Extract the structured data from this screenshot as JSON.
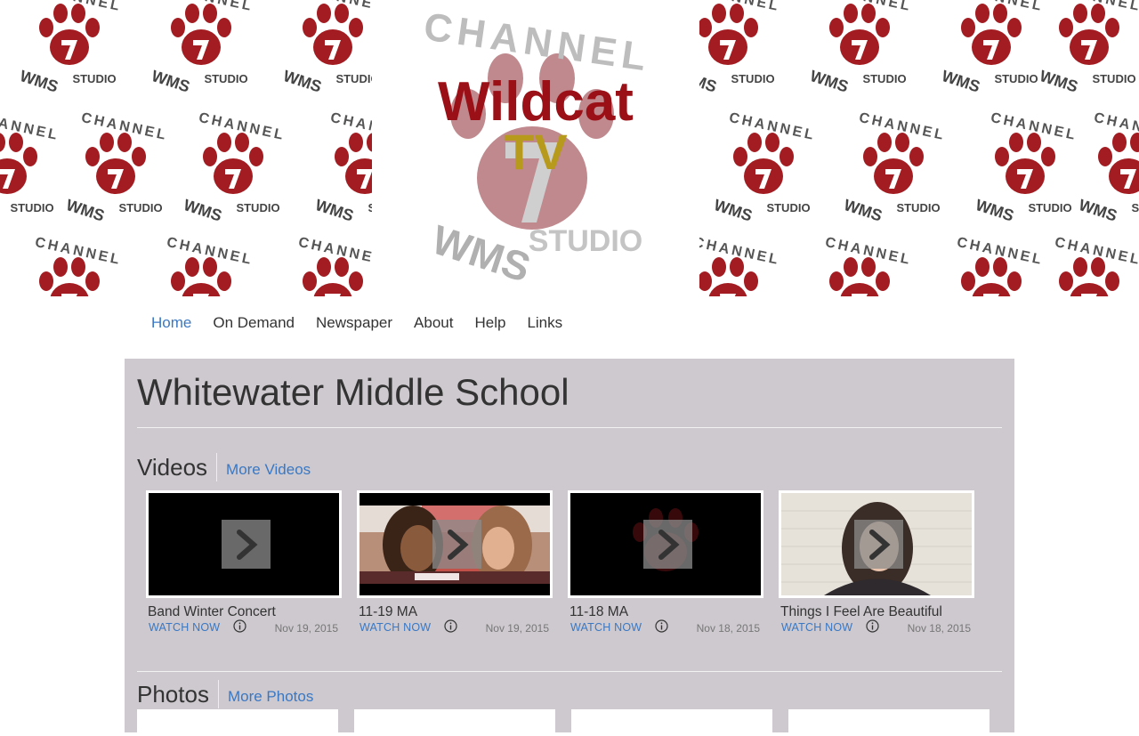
{
  "banner": {
    "tile_top_text": "CHANNEL",
    "tile_bottom_text": "WMS",
    "tile_side_text": "STUDIO",
    "tile_number": "7",
    "logo_title": "Wildcat",
    "logo_subtitle": "TV",
    "colors": {
      "paw": "#a21c21",
      "logo_red": "#9a1016",
      "logo_gold": "#b79a1c",
      "gray_text": "#8a8a8a"
    }
  },
  "nav": {
    "items": [
      {
        "label": "Home",
        "active": true
      },
      {
        "label": "On Demand",
        "active": false
      },
      {
        "label": "Newspaper",
        "active": false
      },
      {
        "label": "About",
        "active": false
      },
      {
        "label": "Help",
        "active": false
      },
      {
        "label": "Links",
        "active": false
      }
    ]
  },
  "page": {
    "title": "Whitewater Middle School"
  },
  "videos": {
    "title": "Videos",
    "more_link": "More Videos",
    "items": [
      {
        "title": "Band Winter Concert",
        "action": "WATCH NOW",
        "date": "Nov 19, 2015",
        "thumb_icon": "blank-video-thumbnail"
      },
      {
        "title": "11-19 MA",
        "action": "WATCH NOW",
        "date": "Nov 19, 2015",
        "thumb_icon": "two-students-thumbnail"
      },
      {
        "title": "11-18 MA",
        "action": "WATCH NOW",
        "date": "Nov 18, 2015",
        "thumb_icon": "channel-logo-thumbnail"
      },
      {
        "title": "Things I Feel Are Beautiful",
        "action": "WATCH NOW",
        "date": "Nov 18, 2015",
        "thumb_icon": "student-portrait-thumbnail"
      }
    ]
  },
  "photos": {
    "title": "Photos",
    "more_link": "More Photos"
  },
  "colors": {
    "accent_link": "#3a78c4",
    "panel_bg": "#cdc9ce",
    "text": "#333333"
  }
}
